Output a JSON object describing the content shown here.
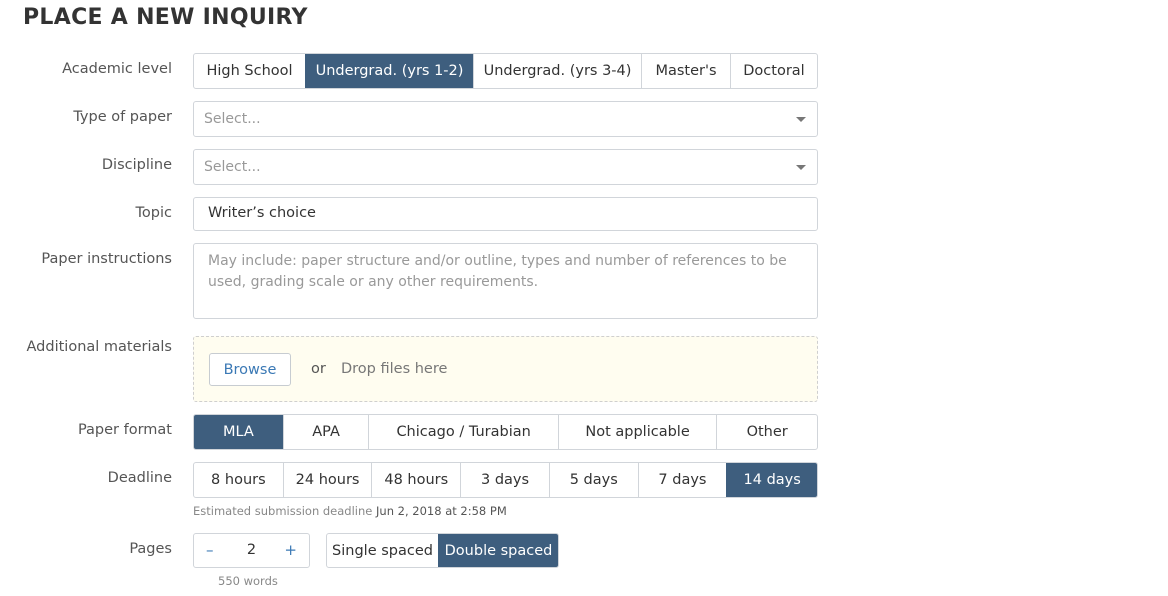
{
  "title": "PLACE A NEW INQUIRY",
  "academic_level": {
    "label": "Academic level",
    "options": [
      "High School",
      "Undergrad. (yrs 1-2)",
      "Undergrad. (yrs 3-4)",
      "Master's",
      "Doctoral"
    ],
    "selected": "Undergrad. (yrs 1-2)"
  },
  "type_of_paper": {
    "label": "Type of paper",
    "placeholder": "Select..."
  },
  "discipline": {
    "label": "Discipline",
    "placeholder": "Select..."
  },
  "topic": {
    "label": "Topic",
    "value": "Writer’s choice"
  },
  "instructions": {
    "label": "Paper instructions",
    "placeholder": "May include: paper structure and/or outline, types and number of references to be used, grading scale or any other requirements."
  },
  "materials": {
    "label": "Additional materials",
    "browse": "Browse",
    "or": "or",
    "drop": "Drop files here"
  },
  "paper_format": {
    "label": "Paper format",
    "options": [
      "MLA",
      "APA",
      "Chicago / Turabian",
      "Not applicable",
      "Other"
    ],
    "selected": "MLA"
  },
  "deadline": {
    "label": "Deadline",
    "options": [
      "8 hours",
      "24 hours",
      "48 hours",
      "3 days",
      "5 days",
      "7 days",
      "14 days"
    ],
    "selected": "14 days",
    "estimate_prefix": "Estimated submission deadline",
    "estimate_date": "Jun 2, 2018 at 2:58 PM"
  },
  "pages": {
    "label": "Pages",
    "minus": "–",
    "value": "2",
    "plus": "+",
    "words": "550 words",
    "spacing_options": [
      "Single spaced",
      "Double spaced"
    ],
    "spacing_selected": "Double spaced"
  },
  "colors": {
    "accent": "#3e5e7e",
    "link": "#3b79b5",
    "drop_bg": "#fffdf0"
  }
}
